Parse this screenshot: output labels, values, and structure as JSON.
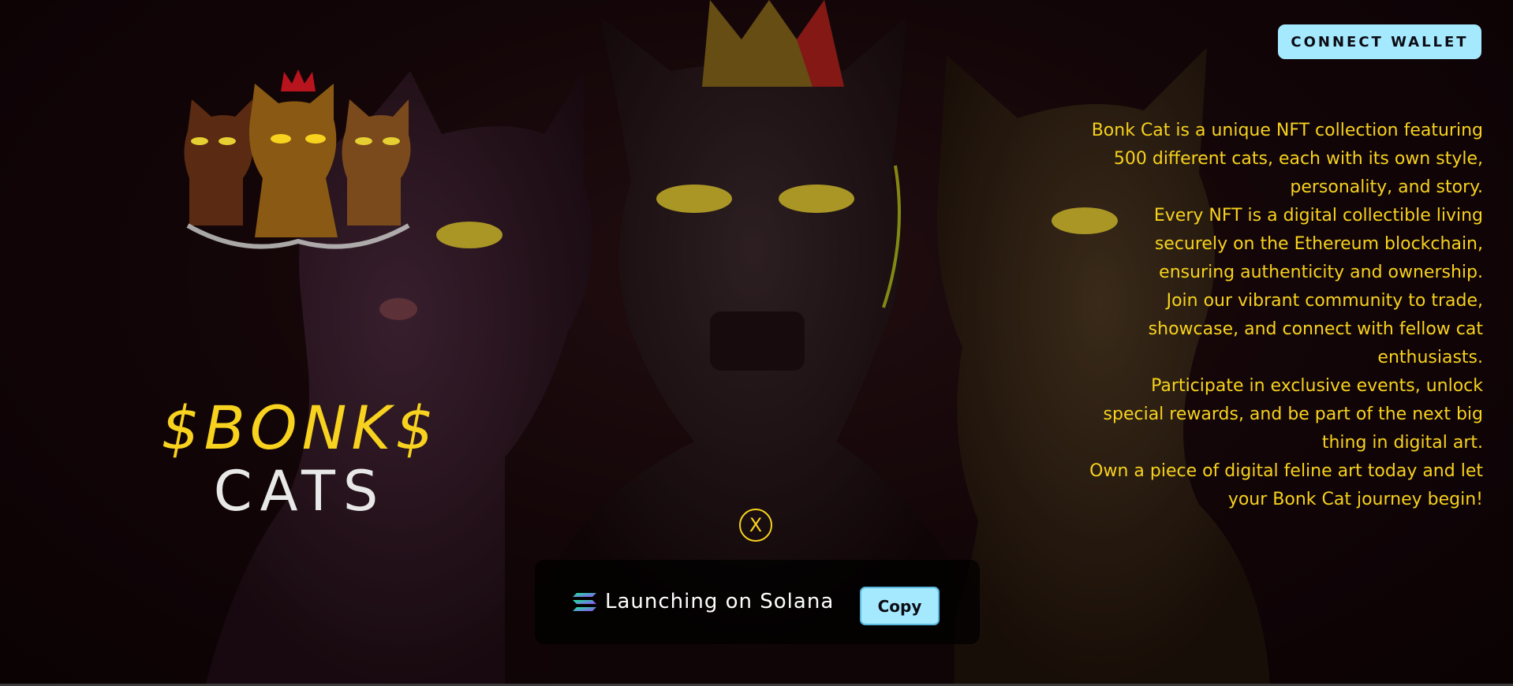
{
  "header": {
    "connect_wallet_label": "CONNECT WALLET"
  },
  "brand": {
    "token": "$BONK$",
    "name": "CATS"
  },
  "description": {
    "paragraphs": [
      "Bonk Cat is a unique NFT collection featuring 500 different cats, each with its own style, personality, and story.",
      "Every NFT is a digital collectible living securely on the Ethereum blockchain, ensuring authenticity and ownership.",
      "Join our vibrant community to trade, showcase, and connect with fellow cat enthusiasts.",
      "Participate in exclusive events, unlock special rewards, and be part of the next big thing in digital art.",
      "Own a piece of digital feline art today and let your Bonk Cat journey begin!"
    ]
  },
  "social": {
    "x_label": "X"
  },
  "launch": {
    "text": "Launching on Solana",
    "copy_label": "Copy",
    "solana_icon": "solana-logo-icon"
  },
  "colors": {
    "accent_yellow": "#f7d21e",
    "button_cyan": "#a5e9ff",
    "background": "#0d0305"
  },
  "icons": {
    "x": "x-logo-icon",
    "solana": "solana-logo-icon"
  }
}
